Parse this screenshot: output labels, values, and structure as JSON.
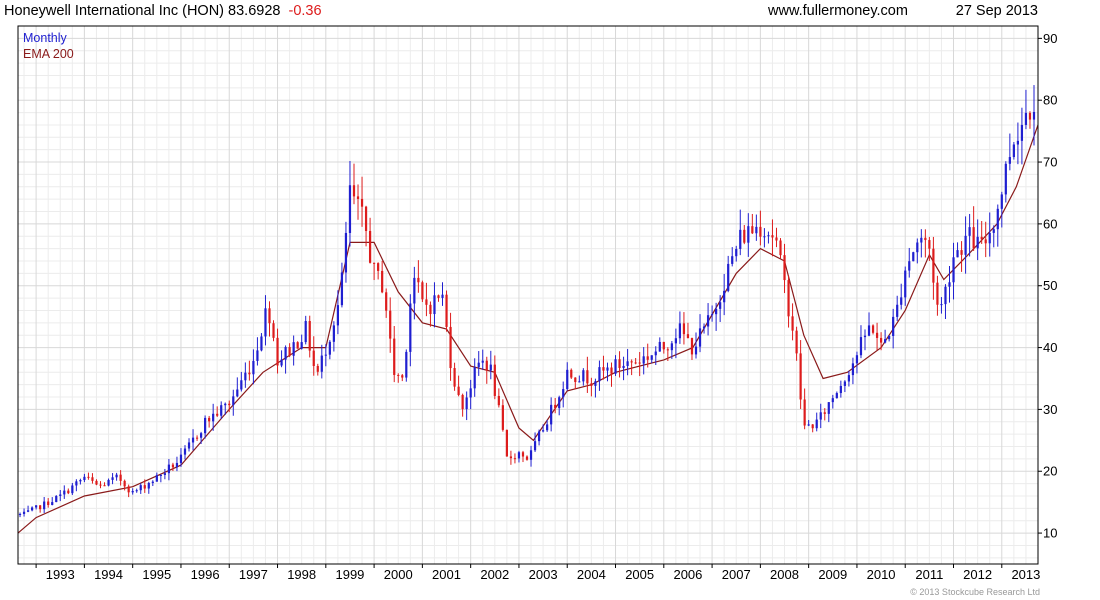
{
  "header": {
    "title_main": "Honeywell International Inc (HON) 83.6928",
    "change": "-0.36",
    "website": "www.fullermoney.com",
    "date": "27 Sep 2013"
  },
  "legend": {
    "period": "Monthly",
    "ema": "EMA 200"
  },
  "copyright": "© 2013 Stockcube Research Ltd",
  "colors": {
    "up": "#1f1fd0",
    "down": "#dd1c1c",
    "ema": "#8a1a1a",
    "grid": "#d8d8d8",
    "axis": "#000000",
    "title": "#000000",
    "change": "#dd1c1c",
    "period_label": "#1f1fd0",
    "ema_label": "#8a1a1a"
  },
  "chart_data": {
    "type": "candlestick",
    "frequency": "monthly",
    "x_start": 1992.625,
    "x_end": 2013.75,
    "x_ticks": [
      "1993",
      "1994",
      "1995",
      "1996",
      "1997",
      "1998",
      "1999",
      "2000",
      "2001",
      "2002",
      "2003",
      "2004",
      "2005",
      "2006",
      "2007",
      "2008",
      "2009",
      "2010",
      "2011",
      "2012",
      "2013"
    ],
    "ylim": [
      5,
      92
    ],
    "y_ticks": [
      10,
      20,
      30,
      40,
      50,
      60,
      70,
      80,
      90
    ],
    "grid": true,
    "y_axis_side": "right",
    "series": [
      {
        "name": "Monthly",
        "kind": "candlestick",
        "anchors": [
          [
            1992.75,
            13
          ],
          [
            1993.0,
            14
          ],
          [
            1993.5,
            16
          ],
          [
            1994.0,
            19
          ],
          [
            1994.3,
            17.5
          ],
          [
            1994.7,
            19
          ],
          [
            1995.0,
            16.5
          ],
          [
            1995.5,
            19
          ],
          [
            1996.0,
            22
          ],
          [
            1996.5,
            28
          ],
          [
            1997.0,
            31
          ],
          [
            1997.5,
            38
          ],
          [
            1997.8,
            47
          ],
          [
            1998.0,
            38
          ],
          [
            1998.3,
            40
          ],
          [
            1998.6,
            43
          ],
          [
            1998.8,
            35
          ],
          [
            1999.0,
            40
          ],
          [
            1999.3,
            48
          ],
          [
            1999.5,
            65
          ],
          [
            1999.8,
            60
          ],
          [
            2000.0,
            52
          ],
          [
            2000.2,
            50
          ],
          [
            2000.4,
            36
          ],
          [
            2000.6,
            35
          ],
          [
            2000.8,
            52
          ],
          [
            2001.0,
            47
          ],
          [
            2001.2,
            47
          ],
          [
            2001.4,
            49
          ],
          [
            2001.6,
            37
          ],
          [
            2001.8,
            30
          ],
          [
            2002.0,
            34
          ],
          [
            2002.2,
            38
          ],
          [
            2002.4,
            37
          ],
          [
            2002.6,
            29
          ],
          [
            2002.75,
            22
          ],
          [
            2003.0,
            23
          ],
          [
            2003.2,
            22
          ],
          [
            2003.5,
            27
          ],
          [
            2003.8,
            32
          ],
          [
            2004.0,
            36
          ],
          [
            2004.5,
            35
          ],
          [
            2005.0,
            37
          ],
          [
            2005.5,
            38
          ],
          [
            2006.0,
            40
          ],
          [
            2006.3,
            43
          ],
          [
            2006.6,
            40
          ],
          [
            2007.0,
            45
          ],
          [
            2007.3,
            52
          ],
          [
            2007.6,
            58
          ],
          [
            2008.0,
            60
          ],
          [
            2008.3,
            58
          ],
          [
            2008.5,
            50
          ],
          [
            2008.7,
            42
          ],
          [
            2008.9,
            27
          ],
          [
            2009.2,
            28
          ],
          [
            2009.5,
            32
          ],
          [
            2009.8,
            36
          ],
          [
            2010.0,
            39
          ],
          [
            2010.3,
            44
          ],
          [
            2010.5,
            40
          ],
          [
            2010.8,
            45
          ],
          [
            2011.0,
            53
          ],
          [
            2011.3,
            58
          ],
          [
            2011.5,
            56
          ],
          [
            2011.7,
            45
          ],
          [
            2011.85,
            50
          ],
          [
            2012.0,
            55
          ],
          [
            2012.3,
            58
          ],
          [
            2012.6,
            56
          ],
          [
            2012.9,
            62
          ],
          [
            2013.2,
            73
          ],
          [
            2013.5,
            78
          ],
          [
            2013.75,
            82
          ]
        ],
        "range_high": 88.5,
        "range_low": 12
      },
      {
        "name": "EMA 200",
        "kind": "line",
        "points": [
          [
            1992.625,
            10
          ],
          [
            1993.0,
            12.5
          ],
          [
            1994.0,
            16
          ],
          [
            1995.0,
            17.5
          ],
          [
            1996.0,
            21
          ],
          [
            1997.0,
            30
          ],
          [
            1997.7,
            36
          ],
          [
            1998.5,
            40
          ],
          [
            1999.0,
            40
          ],
          [
            1999.5,
            57
          ],
          [
            2000.0,
            57
          ],
          [
            2000.5,
            49
          ],
          [
            2001.0,
            44
          ],
          [
            2001.5,
            43
          ],
          [
            2002.0,
            37
          ],
          [
            2002.5,
            36
          ],
          [
            2003.0,
            27
          ],
          [
            2003.3,
            25
          ],
          [
            2004.0,
            33
          ],
          [
            2004.5,
            34
          ],
          [
            2005.0,
            36
          ],
          [
            2006.0,
            38
          ],
          [
            2006.6,
            40
          ],
          [
            2007.5,
            52
          ],
          [
            2008.0,
            56
          ],
          [
            2008.5,
            54
          ],
          [
            2008.9,
            42
          ],
          [
            2009.3,
            35
          ],
          [
            2009.8,
            36
          ],
          [
            2010.5,
            40
          ],
          [
            2011.0,
            46
          ],
          [
            2011.5,
            55
          ],
          [
            2011.8,
            51
          ],
          [
            2012.3,
            55
          ],
          [
            2012.9,
            60
          ],
          [
            2013.3,
            66
          ],
          [
            2013.75,
            76
          ]
        ]
      }
    ]
  }
}
